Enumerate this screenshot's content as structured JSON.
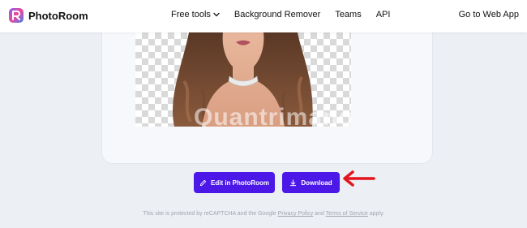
{
  "header": {
    "brand_name": "PhotoRoom",
    "nav": [
      {
        "label": "Free tools",
        "has_dropdown": true
      },
      {
        "label": "Background Remover"
      },
      {
        "label": "Teams"
      },
      {
        "label": "API"
      }
    ],
    "cta_label": "Go to Web App"
  },
  "preview": {
    "watermark_text": "Quantrimang"
  },
  "actions": {
    "edit_label": "Edit in PhotoRoom",
    "download_label": "Download"
  },
  "footer": {
    "prefix": "This site is protected by reCAPTCHA and the Google",
    "privacy_link": "Privacy Policy",
    "and": "and",
    "terms_link": "Terms of Service",
    "suffix": "apply."
  },
  "colors": {
    "accent": "#4c18e8",
    "annotation_arrow": "#e3141b",
    "background": "#eceff4"
  },
  "icons": {
    "logo": "photoroom-logo-icon",
    "dropdown": "chevron-down-icon",
    "edit": "pencil-icon",
    "download": "download-icon",
    "annotation": "red-arrow-icon"
  }
}
